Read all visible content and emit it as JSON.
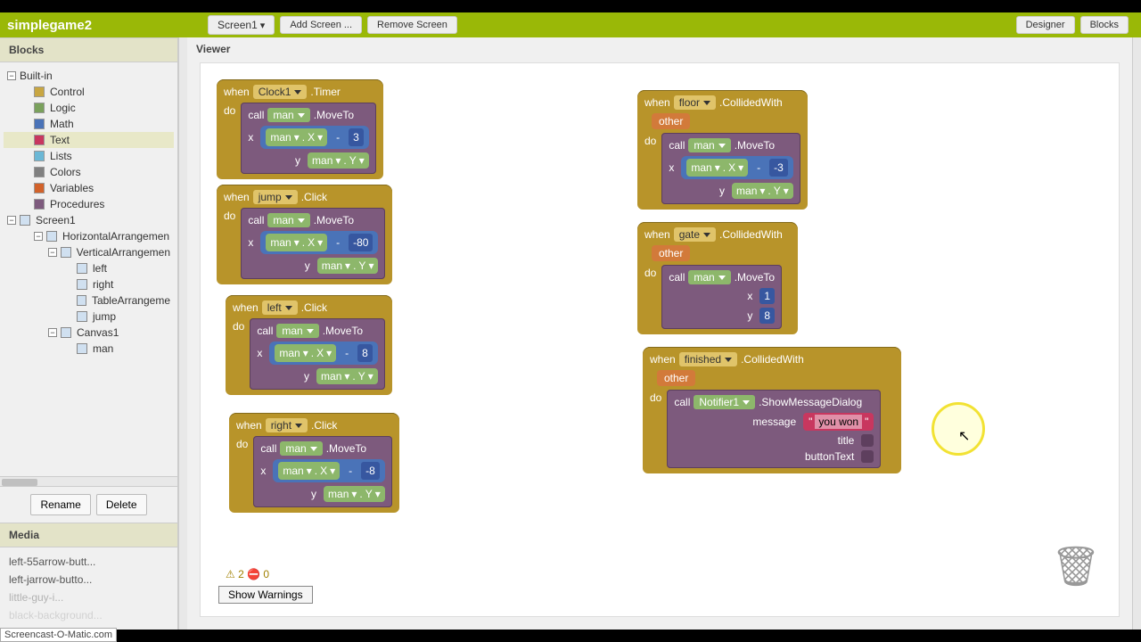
{
  "app_title": "simplegame2",
  "toolbar": {
    "screen_dd": "Screen1",
    "add_screen": "Add Screen ...",
    "remove_screen": "Remove Screen",
    "designer": "Designer",
    "blocks": "Blocks"
  },
  "panels": {
    "blocks_hdr": "Blocks",
    "viewer_hdr": "Viewer",
    "media_hdr": "Media"
  },
  "tree": {
    "builtin": "Built-in",
    "control": "Control",
    "logic": "Logic",
    "math": "Math",
    "text": "Text",
    "lists": "Lists",
    "colors": "Colors",
    "variables": "Variables",
    "procedures": "Procedures",
    "screen1": "Screen1",
    "horiz": "HorizontalArrangemen",
    "vert": "VerticalArrangemen",
    "left": "left",
    "right": "right",
    "table": "TableArrangeme",
    "jump": "jump",
    "canvas": "Canvas1",
    "man": "man"
  },
  "colors": {
    "control": "#c8a642",
    "logic": "#7aa15c",
    "math": "#4a73b8",
    "text": "#c8375f",
    "lists": "#6bb8d6",
    "colors": "#808080",
    "variables": "#d2622a",
    "procedures": "#7d5a7d"
  },
  "sidebar_buttons": {
    "rename": "Rename",
    "delete": "Delete"
  },
  "media": [
    "left-55arrow-butt...",
    "left-jarrow-butto...",
    "little-guy-i...",
    "black-background..."
  ],
  "viewer": {
    "show_warnings": "Show Warnings",
    "warn_text": "⚠ 2    ⛔ 0"
  },
  "labels": {
    "when": "when",
    "do": "do",
    "call": "call",
    "x": "x",
    "y": "y",
    "other": "other",
    "message": "message",
    "title": "title",
    "buttonText": "buttonText",
    "minus": "-",
    "quot": "\""
  },
  "comps": {
    "clock1": "Clock1",
    "man": "man",
    "jump": "jump",
    "left": "left",
    "right": "right",
    "floor": "floor",
    "gate": "gate",
    "finished": "finished",
    "notifier1": "Notifier1"
  },
  "events": {
    "timer": ".Timer",
    "click": ".Click",
    "collided": ".CollidedWith"
  },
  "methods": {
    "moveto": ".MoveTo",
    "showmsg": ".ShowMessageDialog"
  },
  "props": {
    "X": "X",
    "Y": "Y"
  },
  "vals": {
    "three": "3",
    "eighty": "-80",
    "eight": "8",
    "minus_eight": "-8",
    "minus_three": "-3",
    "one": "1",
    "eight2": "8",
    "youwon": "you won"
  },
  "watermark": "Screencast-O-Matic.com"
}
